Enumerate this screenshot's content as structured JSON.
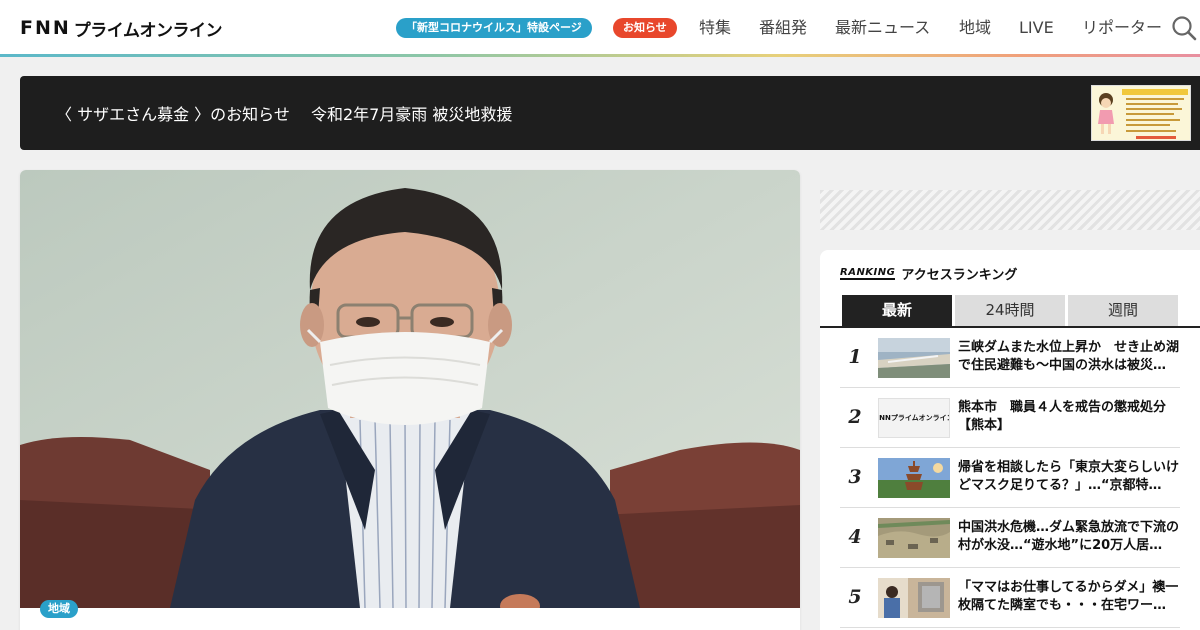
{
  "header": {
    "logo_fnn": "FNN",
    "logo_text": "プライムオンライン",
    "covid_pill": "「新型コロナウイルス」特設ページ",
    "notice_pill": "お知らせ",
    "nav": [
      "特集",
      "番組発",
      "最新ニュース",
      "地域",
      "LIVE",
      "リポーター"
    ]
  },
  "banner": {
    "text": "〈 サザエさん募金 〉のお知らせ　 令和2年7月豪雨 被災地救援"
  },
  "main": {
    "region_badge": "地域"
  },
  "ranking": {
    "logo": "RANKING",
    "title": "アクセスランキング",
    "tabs": [
      "最新",
      "24時間",
      "週間"
    ],
    "items": [
      {
        "rank": "1",
        "text": "三峡ダムまた水位上昇か　せき止め湖で住民避難も～中国の洪水は被災…"
      },
      {
        "rank": "2",
        "text": "熊本市　職員４人を戒告の懲戒処分【熊本】",
        "thumb_text": "FNNプライムオンライン"
      },
      {
        "rank": "3",
        "text": "帰省を相談したら「東京大変らしいけどマスク足りてる？」…“京都特…"
      },
      {
        "rank": "4",
        "text": "中国洪水危機…ダム緊急放流で下流の村が水没…“遊水地”に20万人居…"
      },
      {
        "rank": "5",
        "text": "「ママはお仕事してるからダメ」襖一枚隔てた隣室でも・・・在宅ワー…"
      }
    ]
  },
  "colors": {
    "accent_blue": "#2aa0c9",
    "accent_red": "#e8472c",
    "banner_bg": "#1e1e1e"
  }
}
